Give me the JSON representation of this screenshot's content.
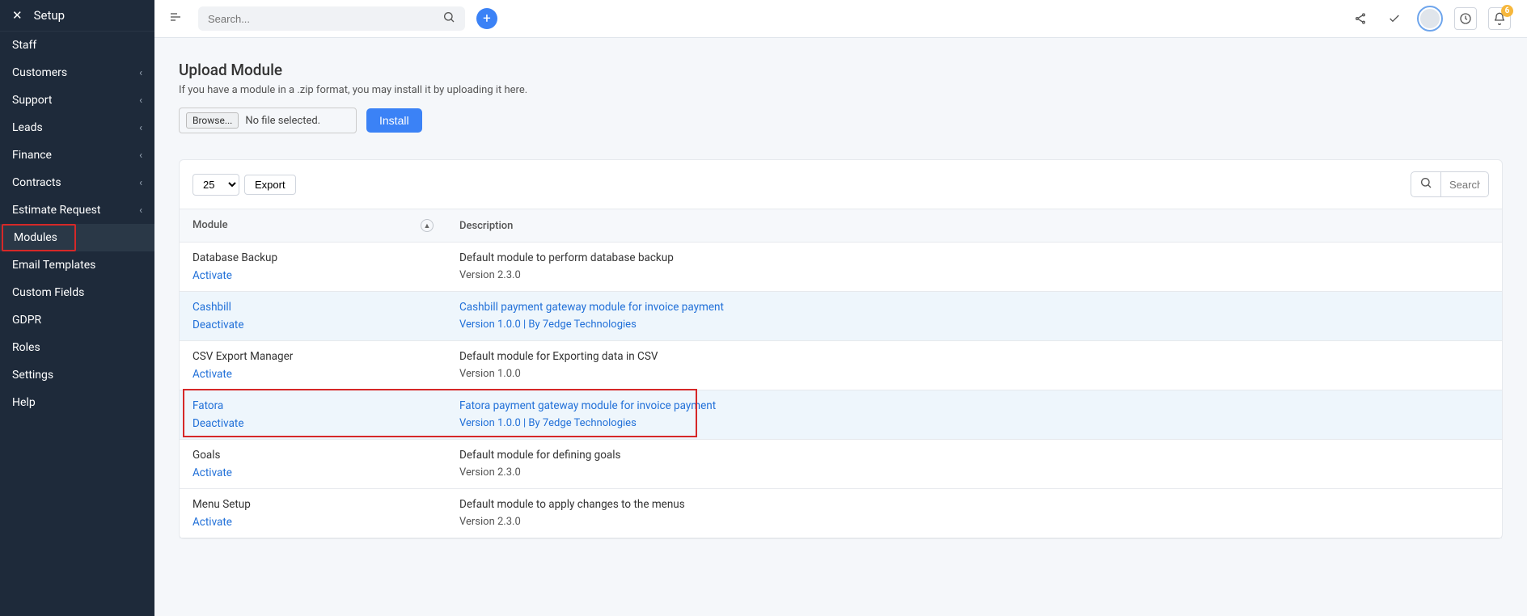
{
  "sidebar": {
    "title": "Setup",
    "items": [
      {
        "label": "Staff",
        "expand": false
      },
      {
        "label": "Customers",
        "expand": true
      },
      {
        "label": "Support",
        "expand": true
      },
      {
        "label": "Leads",
        "expand": true
      },
      {
        "label": "Finance",
        "expand": true
      },
      {
        "label": "Contracts",
        "expand": true
      },
      {
        "label": "Estimate Request",
        "expand": true
      },
      {
        "label": "Modules",
        "expand": false,
        "active": true,
        "highlight": true
      },
      {
        "label": "Email Templates",
        "expand": false
      },
      {
        "label": "Custom Fields",
        "expand": false
      },
      {
        "label": "GDPR",
        "expand": false
      },
      {
        "label": "Roles",
        "expand": false
      },
      {
        "label": "Settings",
        "expand": false
      },
      {
        "label": "Help",
        "expand": false
      }
    ]
  },
  "topbar": {
    "search_placeholder": "Search...",
    "notif_count": "6"
  },
  "page": {
    "title": "Upload Module",
    "subtitle": "If you have a module in a .zip format, you may install it by uploading it here.",
    "browse": "Browse...",
    "no_file": "No file selected.",
    "install": "Install"
  },
  "table": {
    "page_size": "25",
    "export": "Export",
    "search_placeholder": "Search...",
    "columns": {
      "module": "Module",
      "description": "Description"
    },
    "rows": [
      {
        "name": "Database Backup",
        "action": "Activate",
        "desc": "Default module to perform database backup",
        "ver": "Version 2.3.0",
        "active": false,
        "highlight": false
      },
      {
        "name": "Cashbill",
        "action": "Deactivate",
        "desc": "Cashbill payment gateway module for invoice payment",
        "ver": "Version 1.0.0 | By 7edge Technologies",
        "active": true,
        "highlight": false
      },
      {
        "name": "CSV Export Manager",
        "action": "Activate",
        "desc": "Default module for Exporting data in CSV",
        "ver": "Version 1.0.0",
        "active": false,
        "highlight": false
      },
      {
        "name": "Fatora",
        "action": "Deactivate",
        "desc": "Fatora payment gateway module for invoice payment",
        "ver": "Version 1.0.0 | By 7edge Technologies",
        "active": true,
        "highlight": true
      },
      {
        "name": "Goals",
        "action": "Activate",
        "desc": "Default module for defining goals",
        "ver": "Version 2.3.0",
        "active": false,
        "highlight": false
      },
      {
        "name": "Menu Setup",
        "action": "Activate",
        "desc": "Default module to apply changes to the menus",
        "ver": "Version 2.3.0",
        "active": false,
        "highlight": false
      }
    ]
  }
}
